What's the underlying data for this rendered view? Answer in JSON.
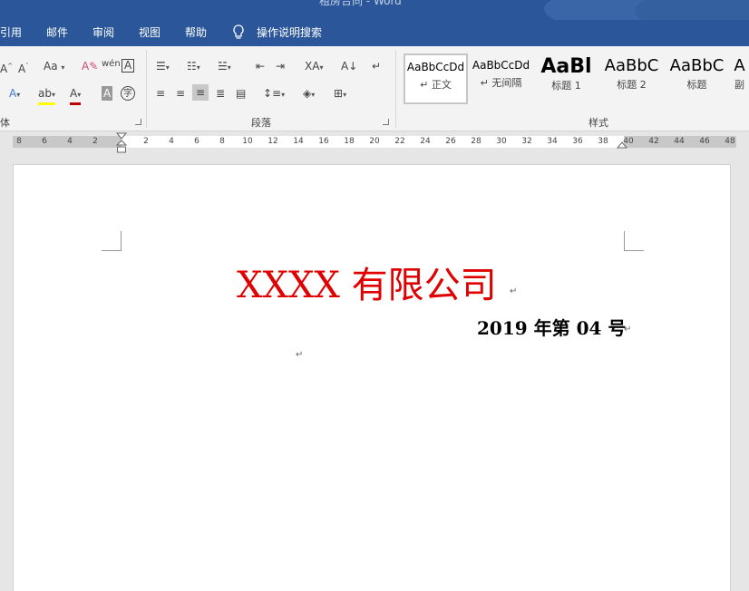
{
  "window": {
    "title": "租房合同  -  Word"
  },
  "tabs": [
    {
      "label": "引用"
    },
    {
      "label": "邮件"
    },
    {
      "label": "审阅"
    },
    {
      "label": "视图"
    },
    {
      "label": "帮助"
    }
  ],
  "tell_me": {
    "label": "操作说明搜索"
  },
  "ribbon": {
    "font_group_label": "体",
    "paragraph_group_label": "段落",
    "styles_group_label": "样式",
    "styles": [
      {
        "sample": "AaBbCcDd",
        "name": "正文",
        "selected": true
      },
      {
        "sample": "AaBbCcDd",
        "name": "无间隔",
        "selected": false
      },
      {
        "sample": "AaBl",
        "name": "标题 1",
        "selected": false
      },
      {
        "sample": "AaBbC",
        "name": "标题 2",
        "selected": false
      },
      {
        "sample": "AaBbC",
        "name": "标题",
        "selected": false
      },
      {
        "sample": "A",
        "name": "副",
        "selected": false
      }
    ]
  },
  "ruler": {
    "left_ticks": [
      "8",
      "6",
      "4",
      "2"
    ],
    "right_ticks": [
      "2",
      "4",
      "6",
      "8",
      "10",
      "12",
      "14",
      "16",
      "18",
      "20",
      "22",
      "24",
      "26",
      "28",
      "30",
      "32",
      "34",
      "36",
      "38",
      "40",
      "42",
      "44",
      "46",
      "48"
    ]
  },
  "document": {
    "title": "XXXX 有限公司",
    "doc_number": "2019 年第 04 号",
    "paragraph_mark": "↵"
  },
  "colors": {
    "brand": "#2b579a",
    "title_red": "#e00000"
  }
}
